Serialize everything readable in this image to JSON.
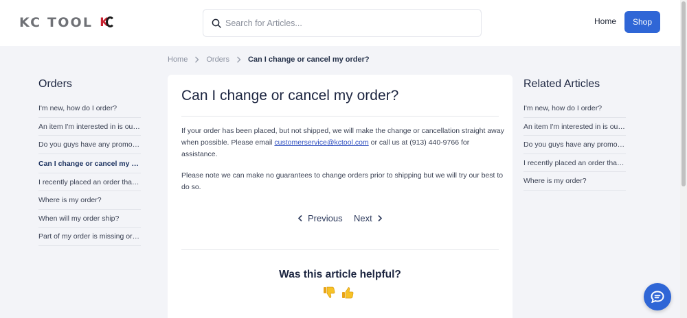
{
  "header": {
    "logo_text": "KC TOOL",
    "logo_mark": "KC",
    "search_placeholder": "Search for Articles...",
    "home_label": "Home",
    "shop_label": "Shop"
  },
  "breadcrumb": {
    "items": [
      "Home",
      "Orders"
    ],
    "current": "Can I change or cancel my order?"
  },
  "left_sidebar": {
    "title": "Orders",
    "items": [
      "I'm new, how do I order?",
      "An item I'm interested in is out of stock",
      "Do you guys have any promos or discounts?",
      "Can I change or cancel my order?",
      "I recently placed an order that never arrived",
      "Where is my order?",
      "When will my order ship?",
      "Part of my order is missing or incorrect"
    ],
    "active_index": 3
  },
  "article": {
    "title": "Can I change or cancel my order?",
    "para1_before": "If your order has been placed, but not shipped, we will make the change or cancellation straight away when possible. Please email ",
    "para1_email": "customerservice@kctool.com",
    "para1_after": " or call us at (913) 440-9766 for assistance.",
    "para2": "Please note we can make no guarantees to change orders prior to shipping but we will try our best to do so.",
    "prev_label": "Previous",
    "next_label": "Next",
    "helpful_question": "Was this article helpful?"
  },
  "right_sidebar": {
    "title": "Related Articles",
    "items": [
      "I'm new, how do I order?",
      "An item I'm interested in is out of stock",
      "Do you guys have any promos or discounts?",
      "I recently placed an order that never arrived",
      "Where is my order?"
    ]
  },
  "icons": {
    "search": "search-icon",
    "chevron_right": "chevron-right-icon",
    "chevron_left": "chevron-left-icon",
    "thumbs_down": "thumbs-down-icon",
    "thumbs_up": "thumbs-up-icon",
    "chat": "chat-bubble-icon"
  },
  "colors": {
    "accent": "#2f66d6",
    "logo_red": "#c8202f",
    "background": "#f3f4f8"
  }
}
